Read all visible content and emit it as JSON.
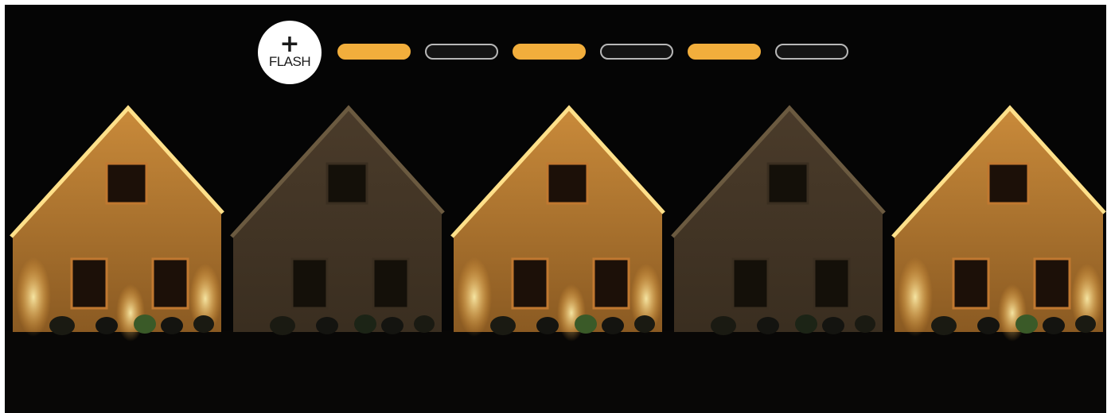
{
  "flash_badge": {
    "symbol": "+",
    "label": "FLASH",
    "icon": "plus-icon"
  },
  "sequence": [
    {
      "state": "on"
    },
    {
      "state": "off"
    },
    {
      "state": "on"
    },
    {
      "state": "off"
    },
    {
      "state": "on"
    },
    {
      "state": "off"
    }
  ],
  "colors": {
    "indicator_on": "#f2ae3c",
    "indicator_off": "#141414",
    "indicator_off_border": "#b8b8b8",
    "badge_bg": "#ffffff"
  }
}
